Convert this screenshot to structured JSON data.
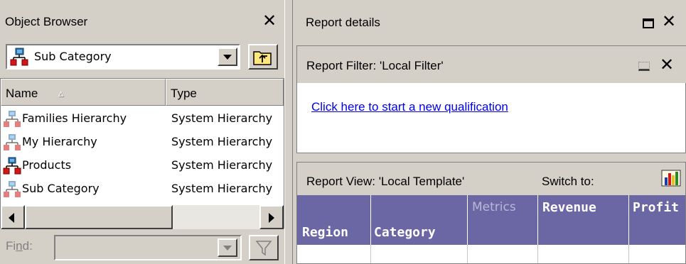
{
  "object_browser": {
    "title": "Object Browser",
    "close_glyph": "✕",
    "selected_folder": "Sub Category",
    "list": {
      "columns": [
        "Name",
        "Type"
      ],
      "sort_indicator": "▵",
      "rows": [
        {
          "name": "Families Hierarchy",
          "type": "System Hierarchy",
          "icon": "hierarchy-icon-faded"
        },
        {
          "name": "My Hierarchy",
          "type": "System Hierarchy",
          "icon": "hierarchy-icon-faded"
        },
        {
          "name": "Products",
          "type": "System Hierarchy",
          "icon": "hierarchy-icon"
        },
        {
          "name": "Sub Category",
          "type": "System Hierarchy",
          "icon": "hierarchy-icon-faded"
        }
      ]
    },
    "find_label": "Fi",
    "find_label_accel": "n",
    "find_label_rest": "d:"
  },
  "report_details": {
    "title": "Report details",
    "close_glyph": "✕"
  },
  "report_filter": {
    "title": "Report Filter: 'Local Filter'",
    "close_glyph": "✕",
    "link": "Click here to start a new qualification"
  },
  "report_view": {
    "title": "Report View: 'Local Template'",
    "switch_label": "Switch to:",
    "grid_headers": {
      "region": "Region",
      "category": "Category",
      "metrics": "Metrics",
      "revenue": "Revenue",
      "profit": "Profit"
    }
  },
  "colors": {
    "grid_header_bg": "#6b67a4",
    "link": "#0000ee",
    "window_bg": "#d4d0c8"
  }
}
